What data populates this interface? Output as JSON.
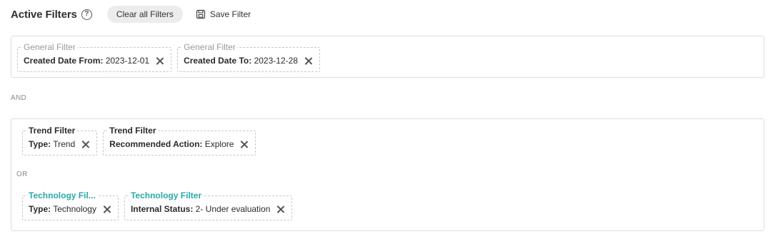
{
  "header": {
    "title": "Active Filters",
    "help_icon": "help-circle-icon",
    "clear_label": "Clear all Filters",
    "save_label": "Save Filter",
    "save_icon": "save-icon"
  },
  "group1": {
    "chips": [
      {
        "legend": "General Filter",
        "key": "Created Date From:",
        "value": "2023-12-01"
      },
      {
        "legend": "General Filter",
        "key": "Created Date To:",
        "value": "2023-12-28"
      }
    ]
  },
  "and_label": "AND",
  "group2": {
    "row1": [
      {
        "legend": "Trend Filter",
        "key": "Type:",
        "value": "Trend"
      },
      {
        "legend": "Trend Filter",
        "key": "Recommended Action:",
        "value": "Explore"
      }
    ],
    "or_label": "OR",
    "row2": [
      {
        "legend": "Technology Fil...",
        "key": "Type:",
        "value": "Technology"
      },
      {
        "legend": "Technology Filter",
        "key": "Internal Status:",
        "value": "2- Under evaluation"
      }
    ]
  },
  "colors": {
    "general_legend": "#9a9a9a",
    "trend_legend": "#2b2b2b",
    "technology_legend": "#29aaa6",
    "chip_border": "#c8c8c8"
  }
}
